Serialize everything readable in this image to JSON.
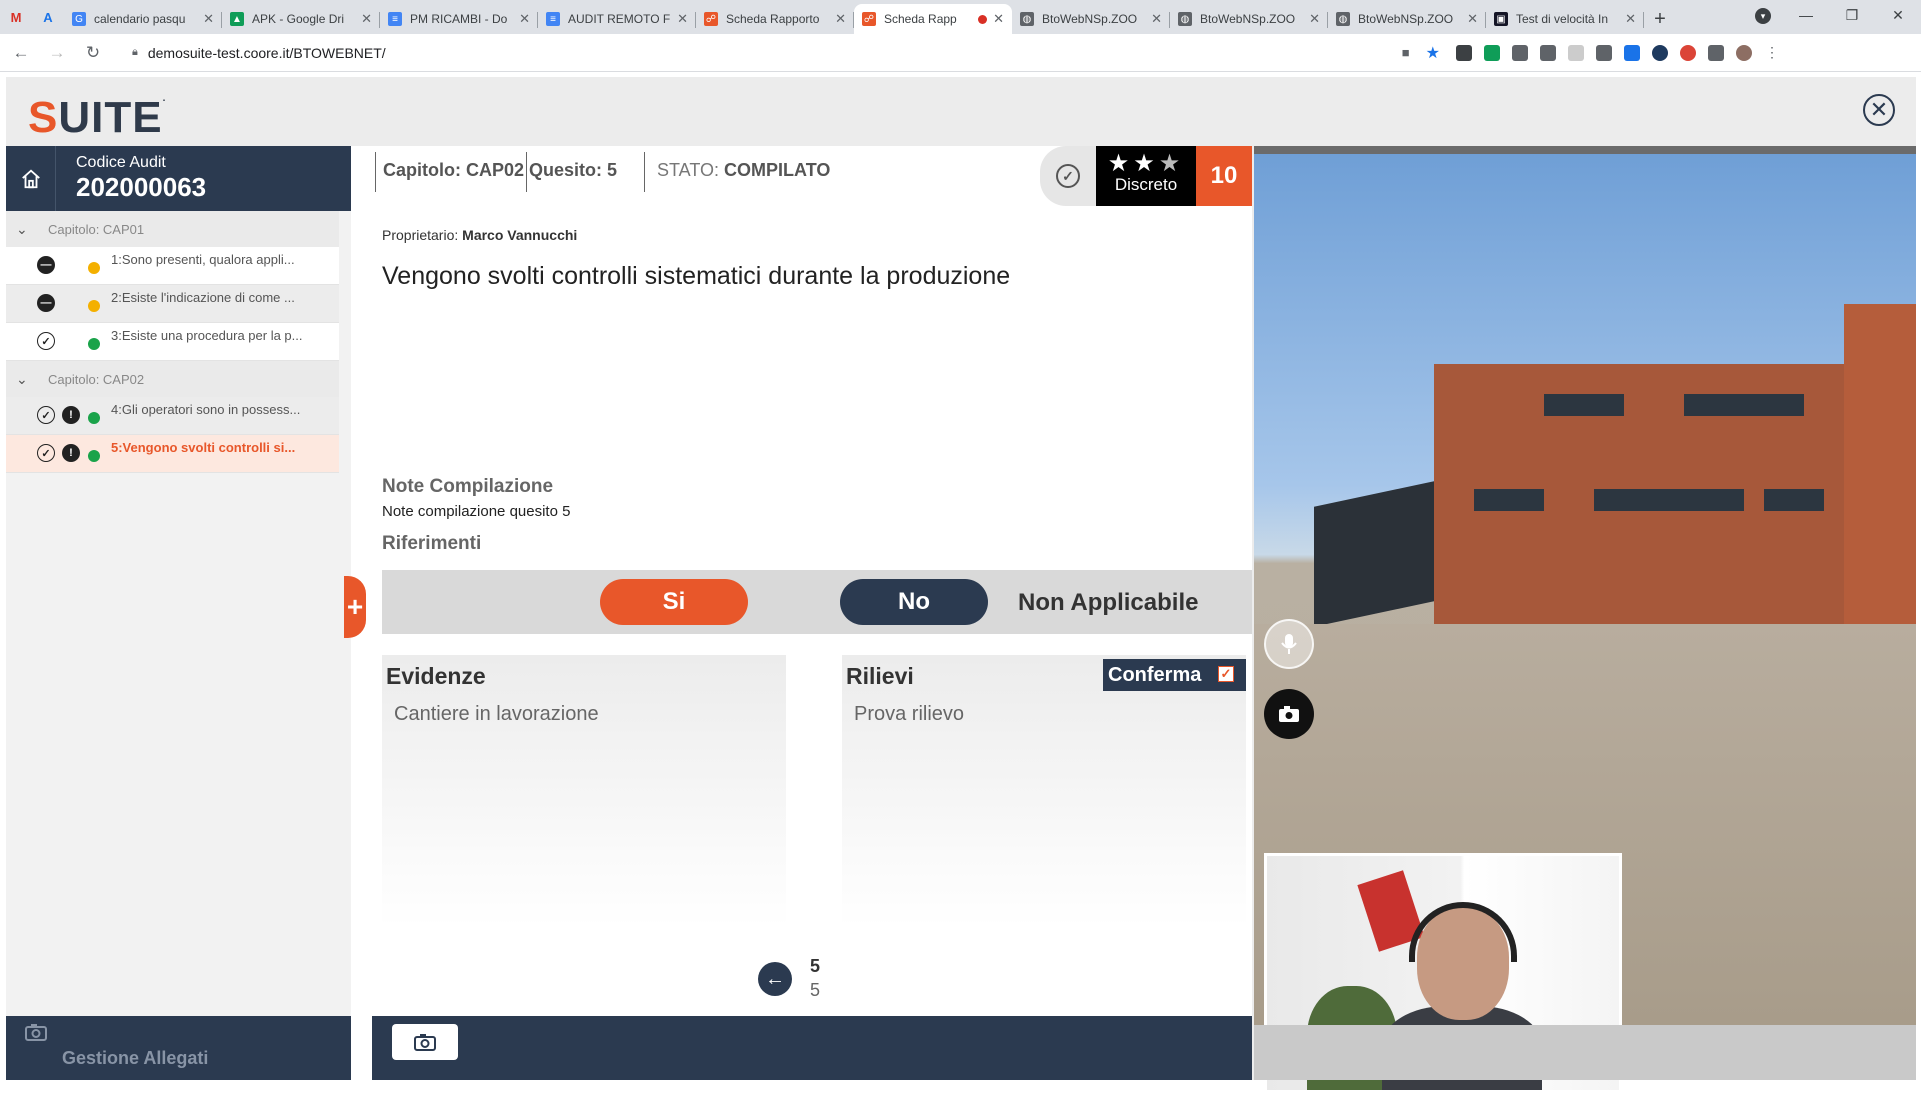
{
  "browser": {
    "pinned_tabs": [
      "M",
      "A"
    ],
    "tabs": [
      {
        "title": "calendario pasqu",
        "color": "#4285f4",
        "glyph": "G"
      },
      {
        "title": "APK - Google Dri",
        "color": "#0f9d58",
        "glyph": "▲"
      },
      {
        "title": "PM RICAMBI - Do",
        "color": "#4285f4",
        "glyph": "≡"
      },
      {
        "title": "AUDIT REMOTO F",
        "color": "#4285f4",
        "glyph": "≡"
      },
      {
        "title": "Scheda Rapporto",
        "color": "#e8572a",
        "glyph": "☍"
      },
      {
        "title": "Scheda Rapp",
        "color": "#e8572a",
        "glyph": "☍",
        "active": true,
        "recording": true
      },
      {
        "title": "BtoWebNSp.ZOO",
        "color": "#5f6368",
        "glyph": "◍"
      },
      {
        "title": "BtoWebNSp.ZOO",
        "color": "#5f6368",
        "glyph": "◍"
      },
      {
        "title": "BtoWebNSp.ZOO",
        "color": "#5f6368",
        "glyph": "◍"
      },
      {
        "title": "Test di velocità In",
        "color": "#141526",
        "glyph": "▣"
      }
    ],
    "url": "demosuite-test.coore.it/BTOWEBNET/"
  },
  "app": {
    "logo_s": "S",
    "logo_rest": "UITE",
    "audit_label": "Codice Audit",
    "audit_code": "202000063",
    "chapters": [
      {
        "label": "Capitolo: CAP01",
        "questions": [
          {
            "text": "1:Sono presenti, qualora appli...",
            "icon1": "minus",
            "icon2": "",
            "dot": "#f4b000",
            "state": ""
          },
          {
            "text": "2:Esiste l'indicazione di come ...",
            "icon1": "minus",
            "icon2": "",
            "dot": "#f4b000",
            "state": "alt"
          },
          {
            "text": "3:Esiste una procedura per la p...",
            "icon1": "check",
            "icon2": "",
            "dot": "#1aa34a",
            "state": ""
          }
        ]
      },
      {
        "label": "Capitolo: CAP02",
        "questions": [
          {
            "text": "4:Gli operatori sono in possess...",
            "icon1": "check",
            "icon2": "excl",
            "dot": "#1aa34a",
            "state": "alt"
          },
          {
            "text": "5:Vengono svolti controlli si...",
            "icon1": "check",
            "icon2": "excl",
            "dot": "#1aa34a",
            "state": "active"
          }
        ]
      }
    ],
    "attachments_label": "Gestione Allegati",
    "question": {
      "chapter": "Capitolo: CAP02",
      "number": "Quesito: 5",
      "status_label": "STATO:",
      "status_value": "COMPILATO",
      "rating_stars_filled": 2,
      "rating_stars_total": 3,
      "rating_label": "Discreto",
      "score": "10",
      "owner_label": "Proprietario:",
      "owner_name": "Marco Vannucchi",
      "text": "Vengono svolti controlli sistematici durante la produzione",
      "notes_label": "Note Compilazione",
      "notes_value": "Note compilazione quesito 5",
      "references_label": "Riferimenti",
      "answer_yes": "Si",
      "answer_no": "No",
      "answer_na": "Non Applicabile",
      "evidence_label": "Evidenze",
      "evidence_value": "Cantiere in lavorazione",
      "findings_label": "Rilievi",
      "findings_value": "Prova rilievo",
      "confirm_label": "Conferma",
      "confirm_checked": true,
      "page_current": "5",
      "page_total": "5"
    }
  },
  "colors": {
    "accent": "#e8572a",
    "navy": "#2b3a50",
    "ok_green": "#1aa34a",
    "warn_yellow": "#f4b000"
  }
}
